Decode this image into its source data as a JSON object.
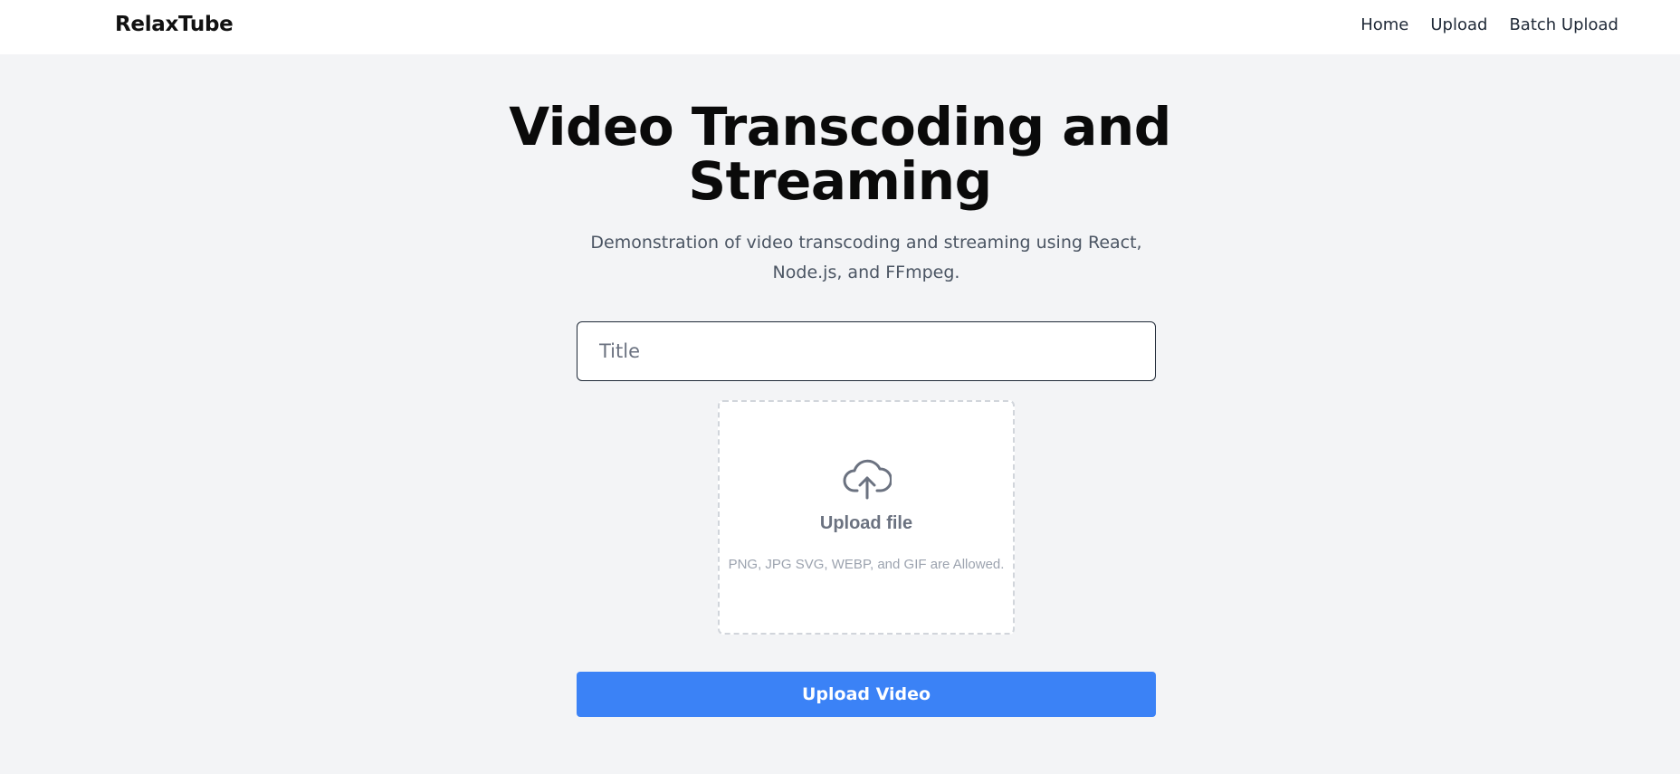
{
  "header": {
    "brand": "RelaxTube",
    "nav": {
      "home": "Home",
      "upload": "Upload",
      "batch_upload": "Batch Upload"
    }
  },
  "hero": {
    "title": "Video Transcoding and Streaming",
    "subtitle": "Demonstration of video transcoding and streaming using React, Node.js, and FFmpeg."
  },
  "form": {
    "title_placeholder": "Title",
    "title_value": "",
    "dropzone": {
      "icon": "cloud-upload-icon",
      "title": "Upload file",
      "hint": "PNG, JPG SVG, WEBP, and GIF are Allowed."
    },
    "submit_label": "Upload Video"
  },
  "colors": {
    "page_bg": "#f3f4f6",
    "primary": "#3b82f6",
    "muted_text": "#6b7280",
    "hint_text": "#9ca3af"
  }
}
